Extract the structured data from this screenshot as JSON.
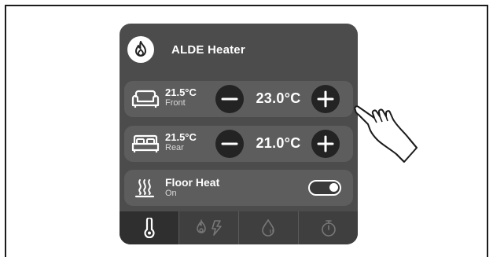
{
  "app": {
    "title": "ALDE Heater"
  },
  "zones": [
    {
      "icon": "sofa-icon",
      "current_temp": "21.5°C",
      "name": "Front",
      "set_temp": "23.0°C"
    },
    {
      "icon": "bed-icon",
      "current_temp": "21.5°C",
      "name": "Rear",
      "set_temp": "21.0°C"
    }
  ],
  "floor_heat": {
    "icon": "floor-heat-icon",
    "label": "Floor Heat",
    "state": "On",
    "enabled": true
  },
  "tabs": [
    {
      "icon": "thermometer-icon",
      "active": true
    },
    {
      "icon": "gas-electric-icon",
      "active": false
    },
    {
      "icon": "hot-water-icon",
      "active": false
    },
    {
      "icon": "timer-icon",
      "active": false
    }
  ],
  "colors": {
    "panel": "#4c4c4c",
    "row": "#5d5d5d",
    "button": "#232323",
    "text": "#ffffff"
  }
}
